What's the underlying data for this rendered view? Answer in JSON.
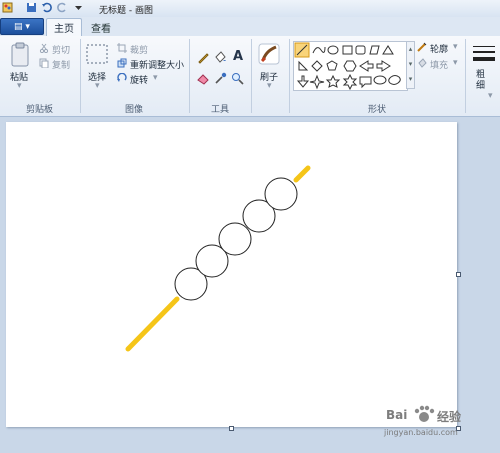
{
  "window": {
    "title": "无标题 - 画图"
  },
  "tabs": {
    "file": "▤ ▾",
    "home": "主页",
    "view": "查看"
  },
  "clipboard": {
    "paste": "粘贴",
    "cut": "剪切",
    "copy": "复制",
    "group": "剪贴板"
  },
  "image": {
    "select": "选择",
    "crop": "裁剪",
    "resize": "重新调整大小",
    "rotate": "旋转",
    "group": "图像"
  },
  "tools": {
    "group": "工具",
    "text_glyph": "A"
  },
  "brushes": {
    "label": "刷子"
  },
  "shapes": {
    "outline": "轮廓",
    "fill": "填充",
    "group": "形状"
  },
  "size": {
    "label": "粗细"
  },
  "watermark": {
    "line1": "Bai",
    "line2": "经验",
    "line3": "jingyan.baidu.com"
  }
}
